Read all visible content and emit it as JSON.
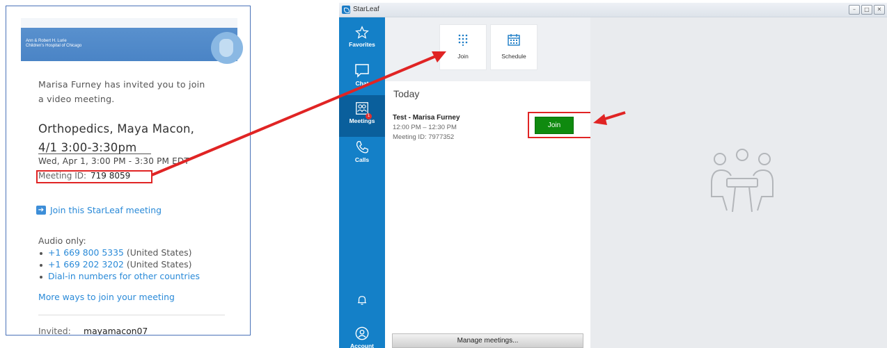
{
  "email": {
    "banner_logo_text": "Ann & Robert H. Lurie\nChildren's Hospital of Chicago",
    "invite_text": "Marisa Furney has invited you to join\na video meeting.",
    "meeting_title": "Orthopedics, Maya Macon,\n4/1 3:00-3:30pm",
    "meeting_date": "Wed, Apr 1, 3:00 PM - 3:30 PM EDT",
    "meeting_id_label": "Meeting ID:",
    "meeting_id_value": "719 8059",
    "join_link": "Join this StarLeaf meeting",
    "audio_label": "Audio only:",
    "phones": [
      {
        "number": "+1 669 800 5335",
        "country": "(United States)"
      },
      {
        "number": "+1 669 202 3202",
        "country": "(United States)"
      }
    ],
    "dial_in_link": "Dial-in numbers for other countries",
    "more_ways_link": "More ways to join your meeting",
    "invited_label": "Invited:",
    "invited_value": "mayamacon07"
  },
  "app": {
    "title": "StarLeaf",
    "sidebar": {
      "favorites": "Favorites",
      "chat": "Chat",
      "meetings": "Meetings",
      "meetings_badge": "1",
      "calls": "Calls",
      "account": "Account"
    },
    "toolbar": {
      "join": "Join",
      "schedule": "Schedule"
    },
    "section_heading": "Today",
    "meeting": {
      "title": "Test - Marisa Furney",
      "time": "12:00 PM – 12:30 PM",
      "id": "Meeting ID: 7977352",
      "join_button": "Join"
    },
    "manage_button": "Manage meetings..."
  },
  "colors": {
    "annotation": "#e02424",
    "sidebar": "#1480c8",
    "join_green": "#0f8a0f",
    "link": "#2a8ad8"
  }
}
